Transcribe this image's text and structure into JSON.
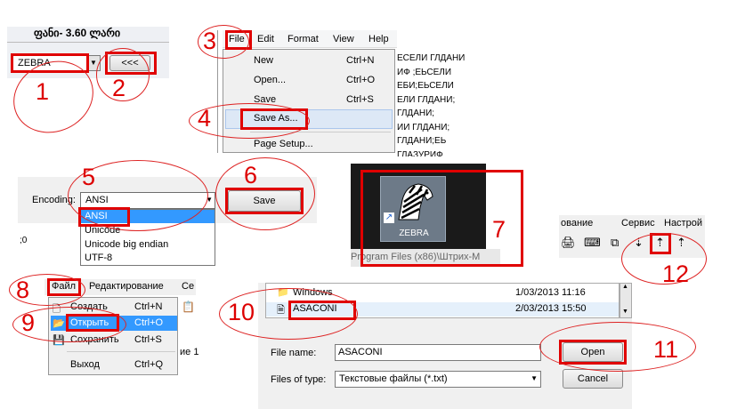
{
  "steps": [
    "1",
    "2",
    "3",
    "4",
    "5",
    "6",
    "7",
    "8",
    "9",
    "10",
    "11",
    "12"
  ],
  "panel1": {
    "caption": "ფანი- 3.60 ლარი",
    "combo_value": "ZEBRA",
    "back_button": "<<<"
  },
  "panel2": {
    "menubar": [
      "File",
      "Edit",
      "Format",
      "View",
      "Help"
    ],
    "menu": [
      {
        "label": "New",
        "shortcut": "Ctrl+N"
      },
      {
        "label": "Open...",
        "shortcut": "Ctrl+O"
      },
      {
        "label": "Save",
        "shortcut": "Ctrl+S"
      },
      {
        "label": "Save As...",
        "shortcut": ""
      },
      {
        "label": "Page Setup...",
        "shortcut": ""
      }
    ],
    "doc_lines": [
      "ЕСЕЛИ ГЛДАНИ",
      "ИФ ;ЕЬСЕЛИ",
      "ЕБИ;ЕЬСЕЛИ",
      "ЕЛИ ГЛДАНИ;",
      "ГЛДАНИ;",
      "ИИ ГЛДАНИ;",
      "ГЛДАНИ;ЕЬ",
      "ГЛАЗУРИФ"
    ]
  },
  "panel3": {
    "encoding_label": "Encoding:",
    "encoding_value": "ANSI",
    "options": [
      "ANSI",
      "Unicode",
      "Unicode big endian",
      "UTF-8"
    ],
    "save_button": "Save",
    "status_text": ";0"
  },
  "panel4": {
    "icon_label": "ZEBRA",
    "path_text": "Program Files (x86)\\Штрих-М"
  },
  "panel5": {
    "menubar": [
      "ование",
      "Сервис",
      "Настрой"
    ]
  },
  "panel6": {
    "menubar": [
      "Файл",
      "Редактирование",
      "Се"
    ],
    "menu": [
      {
        "label": "Создать",
        "shortcut": "Ctrl+N"
      },
      {
        "label": "Открыть",
        "shortcut": "Ctrl+O"
      },
      {
        "label": "Сохранить",
        "shortcut": "Ctrl+S"
      },
      {
        "label": "Выход",
        "shortcut": "Ctrl+Q"
      }
    ],
    "side_text": "ие 1"
  },
  "panel7": {
    "files": [
      {
        "name": "Windows",
        "date": "1/03/2013 11:16"
      },
      {
        "name": "ASACONI",
        "date": "2/03/2013 15:50"
      }
    ],
    "file_name_label": "File name:",
    "file_name_value": "ASACONI",
    "file_type_label": "Files of type:",
    "file_type_value": "Текстовые файлы (*.txt)",
    "open_button": "Open",
    "cancel_button": "Cancel"
  },
  "colors": {
    "annotation": "#e00000",
    "selection": "#3399ff"
  }
}
